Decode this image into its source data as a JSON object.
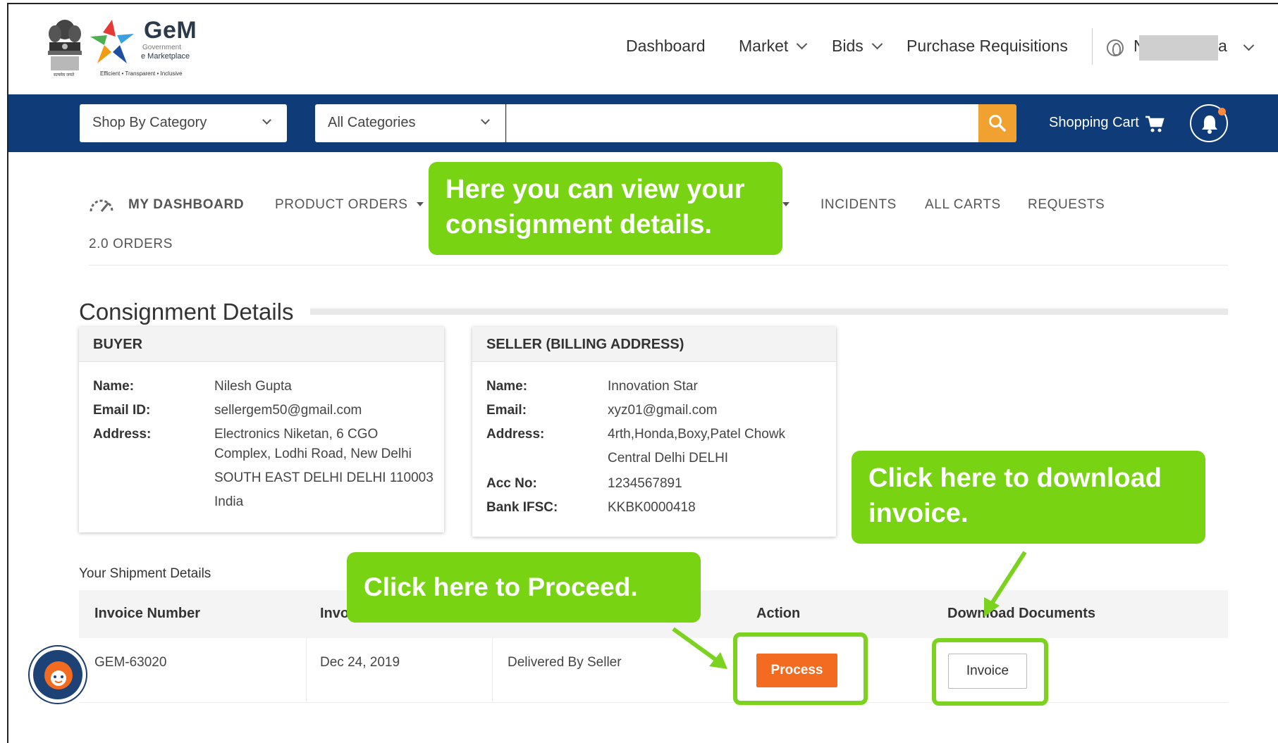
{
  "header": {
    "emblem_caption": "सत्यमेव जयते",
    "brand_name": "GeM",
    "brand_sub1": "Government",
    "brand_sub2": "e Marketplace",
    "brand_tagline": "Efficient • Transparent • Inclusive",
    "nav": {
      "dashboard": "Dashboard",
      "market": "Market",
      "bids": "Bids",
      "purchase_requisitions": "Purchase Requisitions"
    },
    "user": {
      "initial": "N",
      "last": "a"
    }
  },
  "searchbar": {
    "shop_by_category": "Shop By Category",
    "all_categories": "All Categories",
    "search_value": "",
    "shopping_cart": "Shopping Cart",
    "accent_color": "#f0a12f",
    "bar_color": "#0f3b78"
  },
  "dashnav": {
    "my_dashboard": "MY DASHBOARD",
    "product_orders": "PRODUCT ORDERS",
    "incidents": "INCIDENTS",
    "all_carts": "ALL CARTS",
    "requests": "REQUESTS",
    "orders_20": "2.0 ORDERS"
  },
  "consignment": {
    "title": "Consignment Details",
    "buyer": {
      "heading": "BUYER",
      "name_label": "Name:",
      "name": "Nilesh Gupta",
      "email_label": "Email ID:",
      "email": "sellergem50@gmail.com",
      "address_label": "Address:",
      "address_line1": "Electronics Niketan, 6 CGO",
      "address_line2": "Complex, Lodhi Road, New Delhi",
      "address_line3": "SOUTH EAST DELHI DELHI 110003",
      "address_line4": "India"
    },
    "seller": {
      "heading": "SELLER (BILLING ADDRESS)",
      "name_label": "Name:",
      "name": "Innovation Star",
      "email_label": "Email:",
      "email": "xyz01@gmail.com",
      "address_label": "Address:",
      "address_line1": "4rth,Honda,Boxy,Patel Chowk",
      "address_line2": "Central Delhi DELHI",
      "acc_label": "Acc No:",
      "acc_no": "1234567891",
      "ifsc_label": "Bank IFSC:",
      "ifsc": "KKBK0000418"
    }
  },
  "shipment": {
    "title": "Your Shipment Details",
    "headers": {
      "invoice_number": "Invoice Number",
      "invoice_date_partial": "Invo",
      "action": "Action",
      "download_documents": "Download Documents"
    },
    "row": {
      "invoice_number": "GEM-63020",
      "date": "Dec 24, 2019",
      "status": "Delivered By Seller",
      "process_label": "Process",
      "invoice_label": "Invoice"
    }
  },
  "callouts": {
    "consignment": "Here you can view your consignment details.",
    "download": "Click here to download invoice.",
    "proceed": "Click here to Proceed."
  },
  "colors": {
    "callout_green": "#78d312",
    "process_orange": "#f36b21"
  }
}
